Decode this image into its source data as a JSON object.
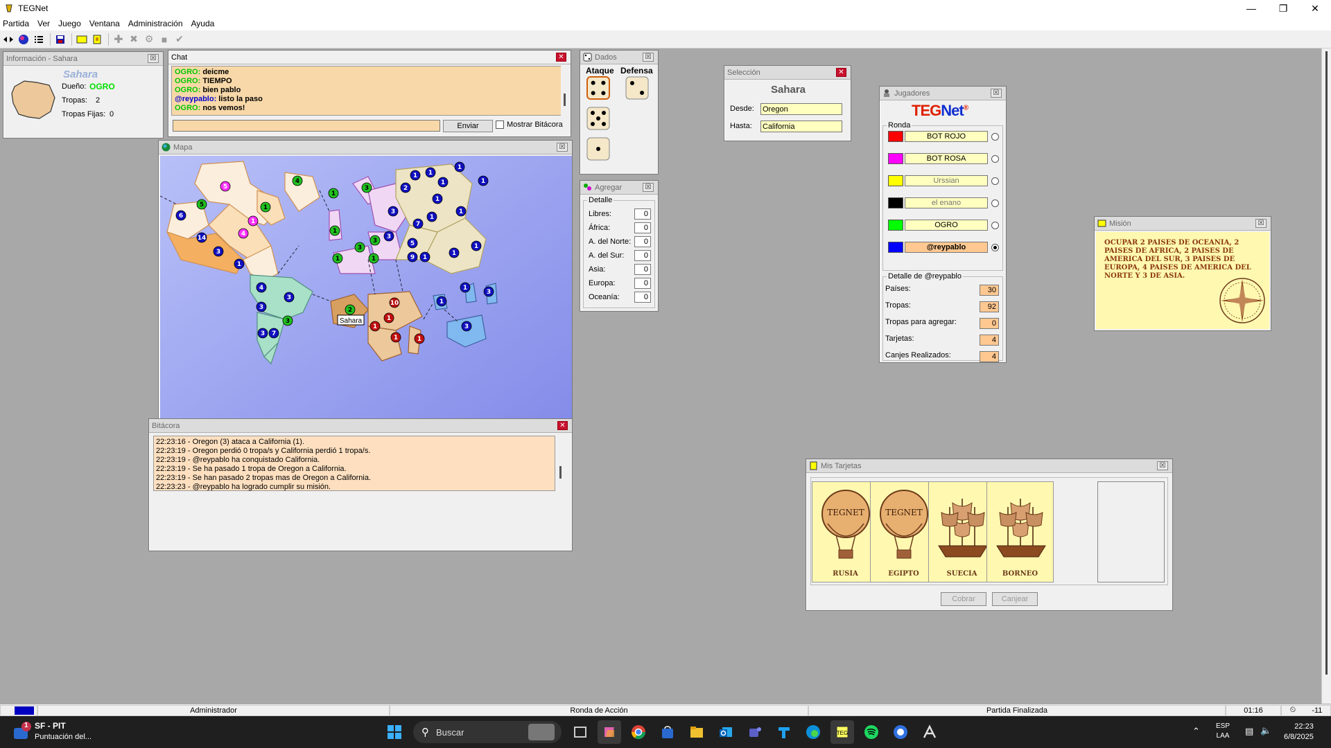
{
  "app": {
    "title": "TEGNet"
  },
  "menu": [
    "Partida",
    "Ver",
    "Juego",
    "Ventana",
    "Administración",
    "Ayuda"
  ],
  "info": {
    "title": "Información - Sahara",
    "country": "Sahara",
    "owner_label": "Dueño:",
    "owner": "OGRO",
    "troops_label": "Tropas:",
    "troops": "2",
    "fixed_label": "Tropas Fijas:",
    "fixed": "0"
  },
  "chat": {
    "title": "Chat",
    "lines": [
      {
        "who": "OGRO:",
        "text": " deicme",
        "color": "#00c800"
      },
      {
        "who": "OGRO:",
        "text": " TIEMPO",
        "color": "#00c800"
      },
      {
        "who": "OGRO:",
        "text": " bien pablo",
        "color": "#00c800"
      },
      {
        "who": "@reypablo:",
        "text": " listo la paso",
        "color": "#0000d0"
      },
      {
        "who": "OGRO:",
        "text": " nos vemos!",
        "color": "#00c800"
      }
    ],
    "send_label": "Enviar",
    "show_log_label": "Mostrar Bitácora"
  },
  "map": {
    "title": "Mapa",
    "tooltip": "Sahara"
  },
  "dice": {
    "title": "Dados",
    "attack_label": "Ataque",
    "defense_label": "Defensa",
    "attack": [
      4,
      5,
      1
    ],
    "defense": [
      2
    ]
  },
  "add": {
    "title": "Agregar",
    "group": "Detalle",
    "rows": [
      {
        "label": "Libres:",
        "value": "0"
      },
      {
        "label": "África:",
        "value": "0"
      },
      {
        "label": "A. del Norte:",
        "value": "0"
      },
      {
        "label": "A. del Sur:",
        "value": "0"
      },
      {
        "label": "Asia:",
        "value": "0"
      },
      {
        "label": "Europa:",
        "value": "0"
      },
      {
        "label": "Oceanía:",
        "value": "0"
      }
    ]
  },
  "selection": {
    "title": "Selección",
    "country": "Sahara",
    "from_label": "Desde:",
    "from": "Oregon",
    "to_label": "Hasta:",
    "to": "California"
  },
  "players": {
    "title": "Jugadores",
    "logo": "TEGNet",
    "logo_reg": "®",
    "round_label": "Ronda",
    "list": [
      {
        "name": "BOT ROJO",
        "color": "#ff0000",
        "text_color": "#000",
        "bg": "#ffffc0"
      },
      {
        "name": "BOT ROSA",
        "color": "#ff00ff",
        "text_color": "#000",
        "bg": "#ffffc0"
      },
      {
        "name": "Urssian",
        "color": "#ffff00",
        "text_color": "#777",
        "bg": "#ffffc0"
      },
      {
        "name": "el enano",
        "color": "#000000",
        "text_color": "#777",
        "bg": "#ffffc0"
      },
      {
        "name": "OGRO",
        "color": "#00ff00",
        "text_color": "#000",
        "bg": "#ffffc0"
      },
      {
        "name": "@reypablo",
        "color": "#0000ff",
        "text_color": "#000",
        "bg": "#ffc890",
        "current": true
      }
    ],
    "detail_label": "Detalle de @reypablo",
    "details": [
      {
        "label": "Países:",
        "value": "30"
      },
      {
        "label": "Tropas:",
        "value": "92"
      },
      {
        "label": "Tropas para agregar:",
        "value": "0"
      },
      {
        "label": "Tarjetas:",
        "value": "4"
      },
      {
        "label": "Canjes Realizados:",
        "value": "4"
      }
    ]
  },
  "mission": {
    "title": "Misión",
    "text": "OCUPAR 2 PAISES DE OCEANIA, 2 PAISES DE AFRICA, 2 PAISES DE AMERICA DEL SUR, 3 PAISES DE EUROPA, 4 PAISES DE AMERICA DEL NORTE Y 3 DE ASIA."
  },
  "log": {
    "title": "Bitácora",
    "lines": [
      "22:23:16 - Oregon (3) ataca a California (1).",
      "22:23:19 - Oregon perdió 0 tropa/s y California perdió 1 tropa/s.",
      "22:23:19 - @reypablo ha conquistado California.",
      "22:23:19 - Se ha pasado 1 tropa de Oregon a California.",
      "22:23:19 - Se han pasado 2 tropas mas de Oregon a California.",
      "22:23:23 - @reypablo ha logrado cumplir su misión."
    ]
  },
  "cards": {
    "title": "Mis Tarjetas",
    "items": [
      {
        "name": "RUSIA",
        "symbol": "balloon"
      },
      {
        "name": "EGIPTO",
        "symbol": "balloon"
      },
      {
        "name": "SUECIA",
        "symbol": "ship"
      },
      {
        "name": "BORNEO",
        "symbol": "ship"
      }
    ],
    "balloon_text": "TEGNET",
    "collect_label": "Cobrar",
    "exchange_label": "Canjear"
  },
  "status": {
    "user": "Administrador",
    "phase": "Ronda de Acción",
    "game": "Partida Finalizada",
    "time": "01:16",
    "value": "-11"
  },
  "taskbar": {
    "notif_count": "1",
    "notif_title": "SF - PIT",
    "notif_sub": "Puntuación del...",
    "search": "Buscar",
    "lang1": "ESP",
    "lang2": "LAA",
    "clock": "22:23",
    "date": "6/8/2025"
  }
}
